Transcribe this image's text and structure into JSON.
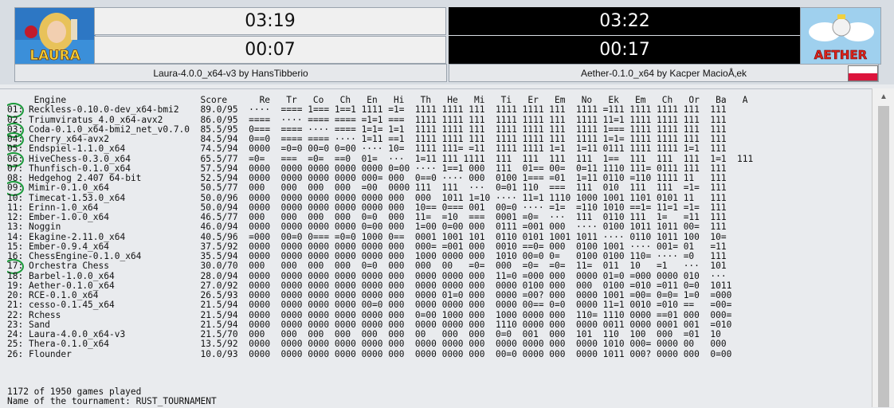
{
  "white": {
    "image_label": "LAURA",
    "time_total": "03:19",
    "time_move": "00:07",
    "name": "Laura-4.0.0_x64-v3 by HansTibberio"
  },
  "black": {
    "image_label": "AETHER",
    "time_total": "03:22",
    "time_move": "00:17",
    "name": "Aether-0.1.0_x64 by Kacper MacioÅ‚ek"
  },
  "table": {
    "header": "     Engine                         Score      Re   Tr   Co   Ch   En   Hi   Th   He   Mi   Ti   Er   Em   No   Ek   Em   Ch   Or   Ba   A",
    "rows": [
      {
        "rank": "01",
        "hl": true,
        "text": " Reckless-0.10.0-dev_x64-bmi2    89.0/95  ····  ==== 1=== 1==1 1111 =1=  1111 1111 111  1111 1111 111  1111 =111 1111 1111 111  111"
      },
      {
        "rank": "02",
        "hl": false,
        "text": " Triumviratus_4.0_x64-avx2       86.0/95  ====  ···· ==== ==== =1=1 ===  1111 1111 111  1111 1111 111  1111 11=1 1111 1111 111  111"
      },
      {
        "rank": "03",
        "hl": true,
        "text": " Coda-0.1.0_x64-bmi2_net_v0.7.0  85.5/95  0===  ==== ···· ==== 1=1= 1=1  1111 1111 111  1111 1111 111  1111 1=== 1111 1111 111  111"
      },
      {
        "rank": "04",
        "hl": true,
        "text": " Cherry_x64-avx2                 84.5/94  0==0  ==== ==== ···· 1=11 ==1  1111 1111 111  1111 1111 111  1111 1=1= 1111 1111 111  111"
      },
      {
        "rank": "05",
        "hl": false,
        "text": " Endspiel-1.1.0_x64              74.5/94  0000  =0=0 00=0 0=00 ···· 10=  1111 111= =11  1111 1111 1=1  1=11 0111 1111 1111 1=1  111"
      },
      {
        "rank": "06",
        "hl": true,
        "text": " HiveChess-0.3.0_x64             65.5/77  =0=   ===  =0=  ==0  01=  ···  1=11 111 1111  111  111  111  111  1==  111  111  111  1=1  111"
      },
      {
        "rank": "07",
        "hl": false,
        "text": " Thunfisch-0.1.0_x64             57.5/94  0000  0000 0000 0000 0000 0=00 ···· 1==1 000  111  01== 00=  0=11 1110 111= 0111 111  111"
      },
      {
        "rank": "08",
        "hl": false,
        "text": " Hedgehog 2.407 64-bit           52.5/94  0000  0000 0000 0000 000= 000  0==0 ···· 000  0100 1=== =01  1=11 0110 =110 1111 11   111"
      },
      {
        "rank": "09",
        "hl": true,
        "text": " Mimir-0.1.0_x64                 50.5/77  000   000  000  000  =00  0000 111  111  ···  0=01 110  ===  111  010  111  111  =1=  111"
      },
      {
        "rank": "10",
        "hl": false,
        "text": " Timecat-1.53.0_x64              50.0/96  0000  0000 0000 0000 0000 000  000  1011 1=10 ···· 11=1 1110 1000 1001 1101 0101 11   111"
      },
      {
        "rank": "11",
        "hl": false,
        "text": " Erinn-1.0_x64                   50.0/94  0000  0000 0000 0000 0000 000  10== 0=== 001  00=0 ···· =1=  =110 1010 ==1= 11=1 =1=  111"
      },
      {
        "rank": "12",
        "hl": false,
        "text": " Ember-1.0.0_x64                 46.5/77  000   000  000  000  0=0  000  11=  =10  ===  0001 =0=  ···  111  0110 111  1=   =11  111"
      },
      {
        "rank": "13",
        "hl": false,
        "text": " Noggin                          46.0/94  0000  0000 0000 0000 0=00 000  1=00 0=00 000  0111 =001 000  ···· 0100 1011 1011 00=  111"
      },
      {
        "rank": "14",
        "hl": false,
        "text": " Ekagine-2.11.0_x64              40.5/96  =000  00=0 0=== =0=0 1000 0==  0001 1001 101  0110 0101 1001 1011 ···· 0110 1011 100  10="
      },
      {
        "rank": "15",
        "hl": false,
        "text": " Ember-0.9.4_x64                 37.5/92  0000  0000 0000 0000 0000 000  000= =001 000  0010 ==0= 000  0100 1001 ···· 001= 01   =11"
      },
      {
        "rank": "16",
        "hl": false,
        "text": " ChessEngine-0.1.0_x64           35.5/94  0000  0000 0000 0000 0000 000  1000 0000 000  1010 00=0 0=   0100 0100 110= ···· =0   111"
      },
      {
        "rank": "17",
        "hl": true,
        "text": " Orchestra Chess                 30.0/70  000   000  000  000  0=0  000  000  00   =0=  000  =0=  =0=  11=  011  10   =1   ···  101"
      },
      {
        "rank": "18",
        "hl": false,
        "text": " Barbel-1.0.0_x64                28.0/94  0000  0000 0000 0000 0000 000  0000 0000 000  11=0 =000 000  0000 01=0 =000 0000 010  ···"
      },
      {
        "rank": "19",
        "hl": false,
        "text": " Aether-0.1.0_x64                27.0/92  0000  0000 0000 0000 0000 000  0000 0000 000  0000 0100 000  000  0100 =010 =011 0=0  1011"
      },
      {
        "rank": "20",
        "hl": false,
        "text": " RCE-0.1.0_x64                   26.5/93  0000  0000 0000 0000 0000 000  0000 01=0 000  0000 =00? 000  0000 1001 =00= 0=0= 1=0  =000"
      },
      {
        "rank": "21",
        "hl": false,
        "text": " cesso-0.1.45_x64                21.5/94  0000  0000 0000 0000 00=0 000  0000 0000 000  0000 00== 0=0  0000 11=1 0010 =010 ==   =00="
      },
      {
        "rank": "22",
        "hl": false,
        "text": " Rchess                          21.5/94  0000  0000 0000 0000 0000 000  0=00 1000 000  1000 0000 000  110= 1110 0000 ==01 000  000="
      },
      {
        "rank": "23",
        "hl": false,
        "text": " Sand                            21.5/94  0000  0000 0000 0000 0000 000  0000 0000 000  1110 0000 000  0000 0011 0000 0001 001  =010"
      },
      {
        "rank": "24",
        "hl": false,
        "text": " Laura-4.0.0_x64-v3              21.5/70  000   000  000  000  000  000  00   000  000  0=0  001  000  101  110  100  000  =01  10"
      },
      {
        "rank": "25",
        "hl": false,
        "text": " Thera-0.1.0_x64                 13.5/92  0000  0000 0000 0000 0000 000  0000 0000 000  0000 0000 000  0000 1010 000= 0000 00   000"
      },
      {
        "rank": "26",
        "hl": false,
        "text": " Flounder                        10.0/93  0000  0000 0000 0000 0000 000  0000 0000 000  00=0 0000 000  0000 1011 000? 0000 000  0=00"
      }
    ]
  },
  "footer": {
    "games": "1172 of 1950 games played",
    "tournament": "Name of the tournament: RUST_TOURNAMENT"
  },
  "colors": {
    "highlight_circle": "#1a9a3a",
    "flag_top": "#ffffff",
    "flag_bottom": "#dc143c"
  }
}
